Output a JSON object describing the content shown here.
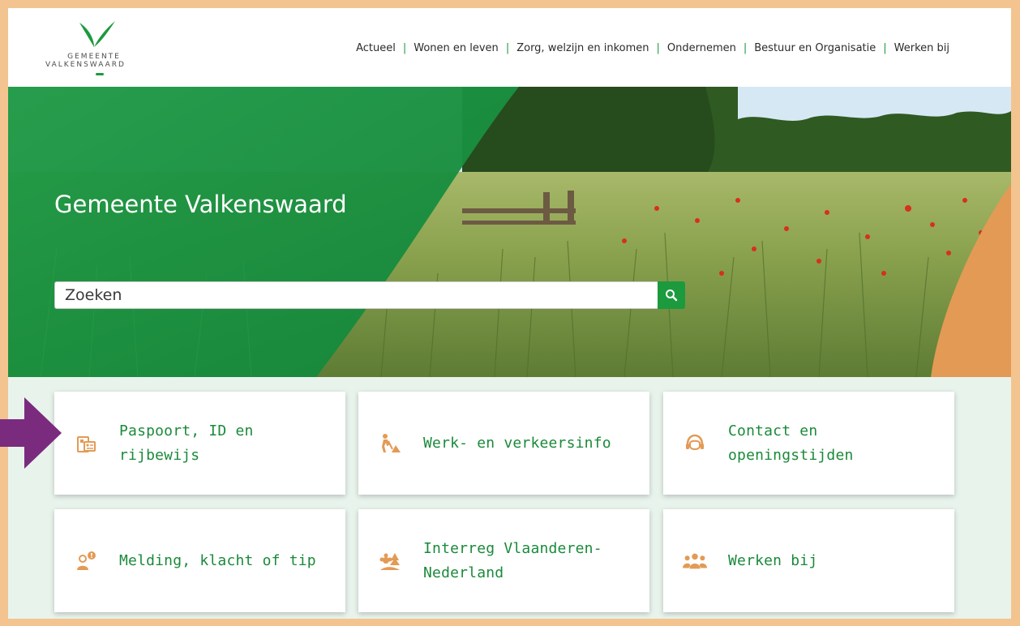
{
  "logo": {
    "line1": "GEMEENTE",
    "line2": "VALKENSWAARD"
  },
  "nav": {
    "items": [
      {
        "label": "Actueel"
      },
      {
        "label": "Wonen en leven"
      },
      {
        "label": "Zorg, welzijn en inkomen"
      },
      {
        "label": "Ondernemen"
      },
      {
        "label": "Bestuur en Organisatie"
      },
      {
        "label": "Werken bij"
      }
    ]
  },
  "hero": {
    "title": "Gemeente Valkenswaard"
  },
  "search": {
    "placeholder": "Zoeken"
  },
  "tiles": {
    "items": [
      {
        "label": "Paspoort, ID en rijbewijs",
        "icon": "passport-icon"
      },
      {
        "label": "Werk- en verkeersinfo",
        "icon": "roadwork-icon"
      },
      {
        "label": "Contact en openingstijden",
        "icon": "headset-icon"
      },
      {
        "label": "Melding, klacht of tip",
        "icon": "report-person-icon"
      },
      {
        "label": "Interreg Vlaanderen-Nederland",
        "icon": "nature-icon"
      },
      {
        "label": "Werken bij",
        "icon": "people-icon"
      }
    ]
  },
  "colors": {
    "brand_green": "#1c9a3e",
    "accent_orange": "#e8a05c",
    "frame": "#f3c48f",
    "arrow_purple": "#7b2b7e"
  }
}
